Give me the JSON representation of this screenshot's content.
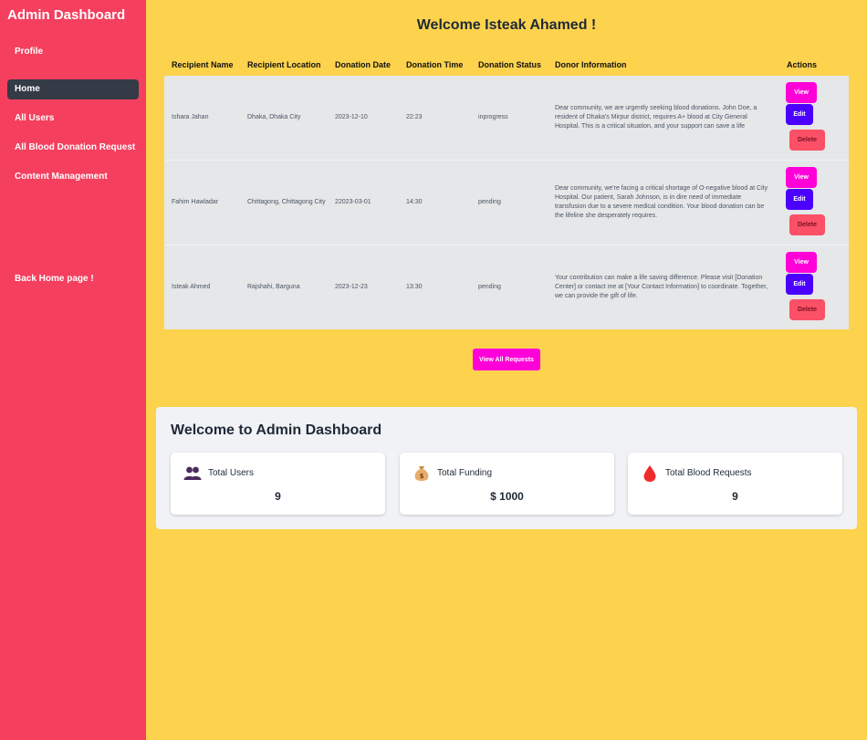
{
  "sidebar": {
    "brand": "Admin Dashboard",
    "items": [
      {
        "label": "Profile"
      },
      {
        "label": "Home"
      },
      {
        "label": "All Users"
      },
      {
        "label": "All Blood Donation Request"
      },
      {
        "label": "Content Management"
      },
      {
        "label": "Back Home page !"
      }
    ]
  },
  "main": {
    "welcome": "Welcome Isteak Ahamed !",
    "table": {
      "headers": [
        "Recipient Name",
        "Recipient Location",
        "Donation Date",
        "Donation Time",
        "Donation Status",
        "Donor Information",
        "Actions"
      ],
      "rows": [
        {
          "name": "Ishara Jahan",
          "location": "Dhaka, Dhaka City",
          "date": "2023-12-10",
          "time": "22:23",
          "status": "inprogress",
          "info": "Dear community, we are urgently seeking blood donations. John Doe, a resident of Dhaka's Mirpur district, requires A+ blood at City General Hospital. This is a critical situation, and your support can save a life"
        },
        {
          "name": "Fahim Hawladar",
          "location": "Chittagong, Chittagong City",
          "date": "22023-03-01",
          "time": "14:30",
          "status": "pending",
          "info": "Dear community, we're facing a critical shortage of O-negative blood at City Hospital. Our patient, Sarah Johnson, is in dire need of immediate transfusion due to a severe medical condition. Your blood donation can be the lifeline she desperately requires."
        },
        {
          "name": "Isteak Ahmed",
          "location": "Rajshahi, Barguna",
          "date": "2023-12-23",
          "time": "13:30",
          "status": "pending",
          "info": "Your contribution can make a life saving difference. Please visit [Donation Center] or contact me at [Your Contact Information] to coordinate. Together, we can provide the gift of life."
        }
      ],
      "actions": {
        "view": "View",
        "edit": "Edit",
        "delete": "Delete"
      }
    },
    "view_all": "View All Requests"
  },
  "stats": {
    "title": "Welcome to Admin Dashboard",
    "cards": [
      {
        "label": "Total Users",
        "value": "9",
        "icon": "users-icon"
      },
      {
        "label": "Total Funding",
        "value": "$ 1000",
        "icon": "money-bag-icon"
      },
      {
        "label": "Total Blood Requests",
        "value": "9",
        "icon": "blood-drop-icon"
      }
    ]
  },
  "colors": {
    "sidebar": "#f43f5e",
    "background": "#fdd34d",
    "view": "#ff00d9",
    "edit": "#4b00ff",
    "delete": "#fb5066"
  }
}
